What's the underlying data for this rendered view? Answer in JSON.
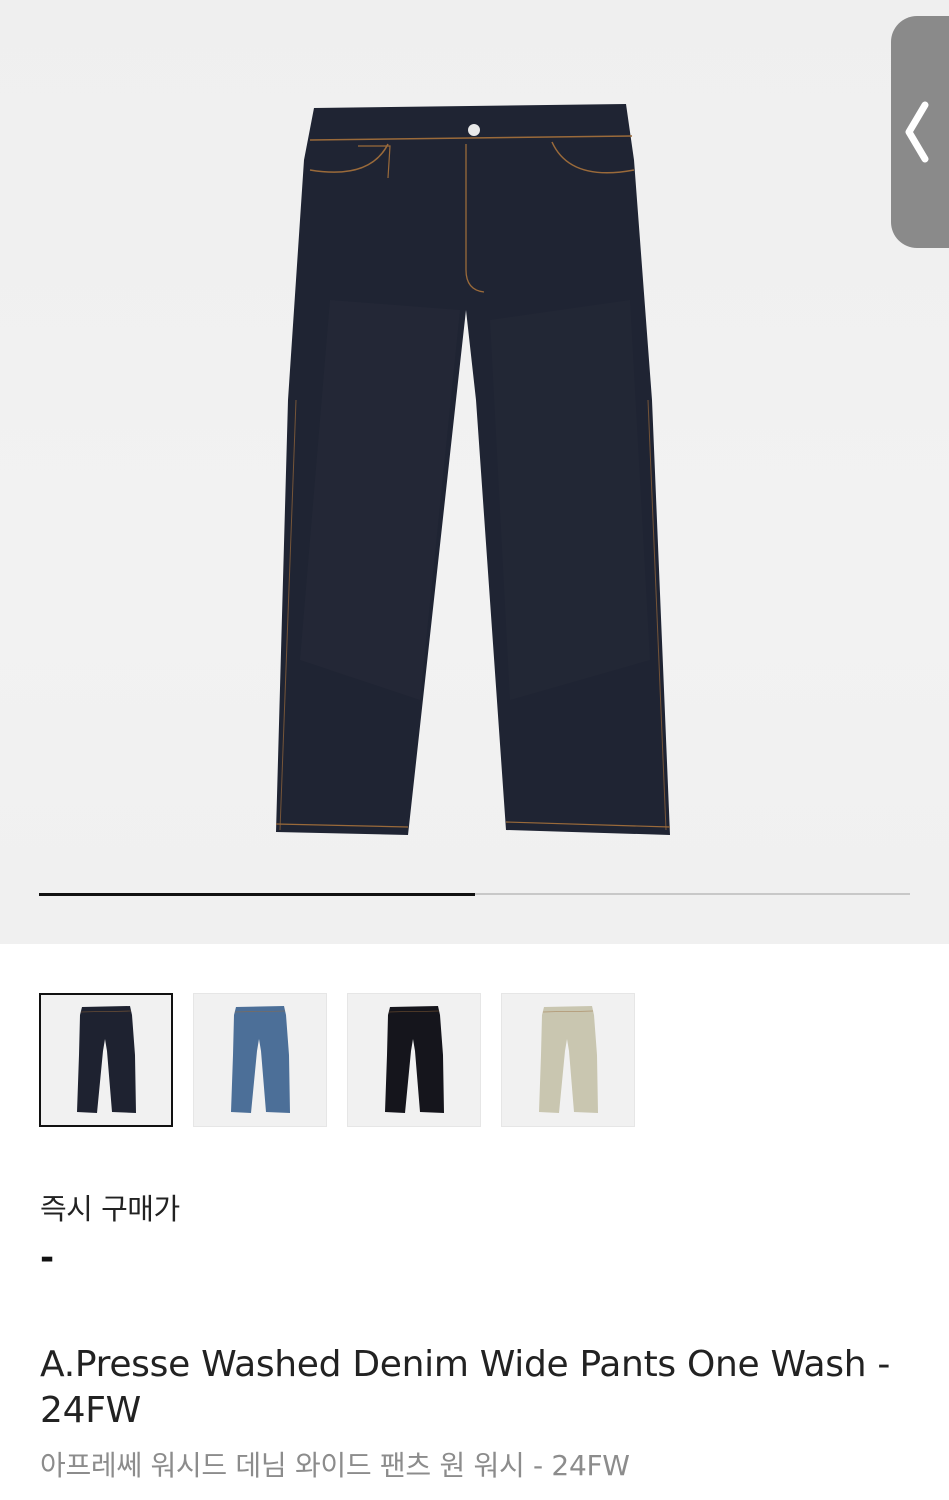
{
  "product": {
    "price_label": "즉시 구매가",
    "price_value": "-",
    "title_en": "A.Presse Washed Denim Wide Pants One Wash - 24FW",
    "title_kr": "아프레쎄 워시드 데님 와이드 팬츠 원 워시 - 24FW"
  },
  "gallery": {
    "progress": 0.5,
    "thumbnails": [
      {
        "name": "one-wash",
        "color": "#1e2230",
        "selected": true
      },
      {
        "name": "light-blue",
        "color": "#4c6f98",
        "selected": false
      },
      {
        "name": "black",
        "color": "#15151c",
        "selected": false
      },
      {
        "name": "vintage-bleach",
        "color": "#c9c6b0",
        "selected": false
      }
    ]
  },
  "colors": {
    "denim_main": "#1e2230",
    "stitch": "#a0703e",
    "handle": "#8a8a8a"
  }
}
